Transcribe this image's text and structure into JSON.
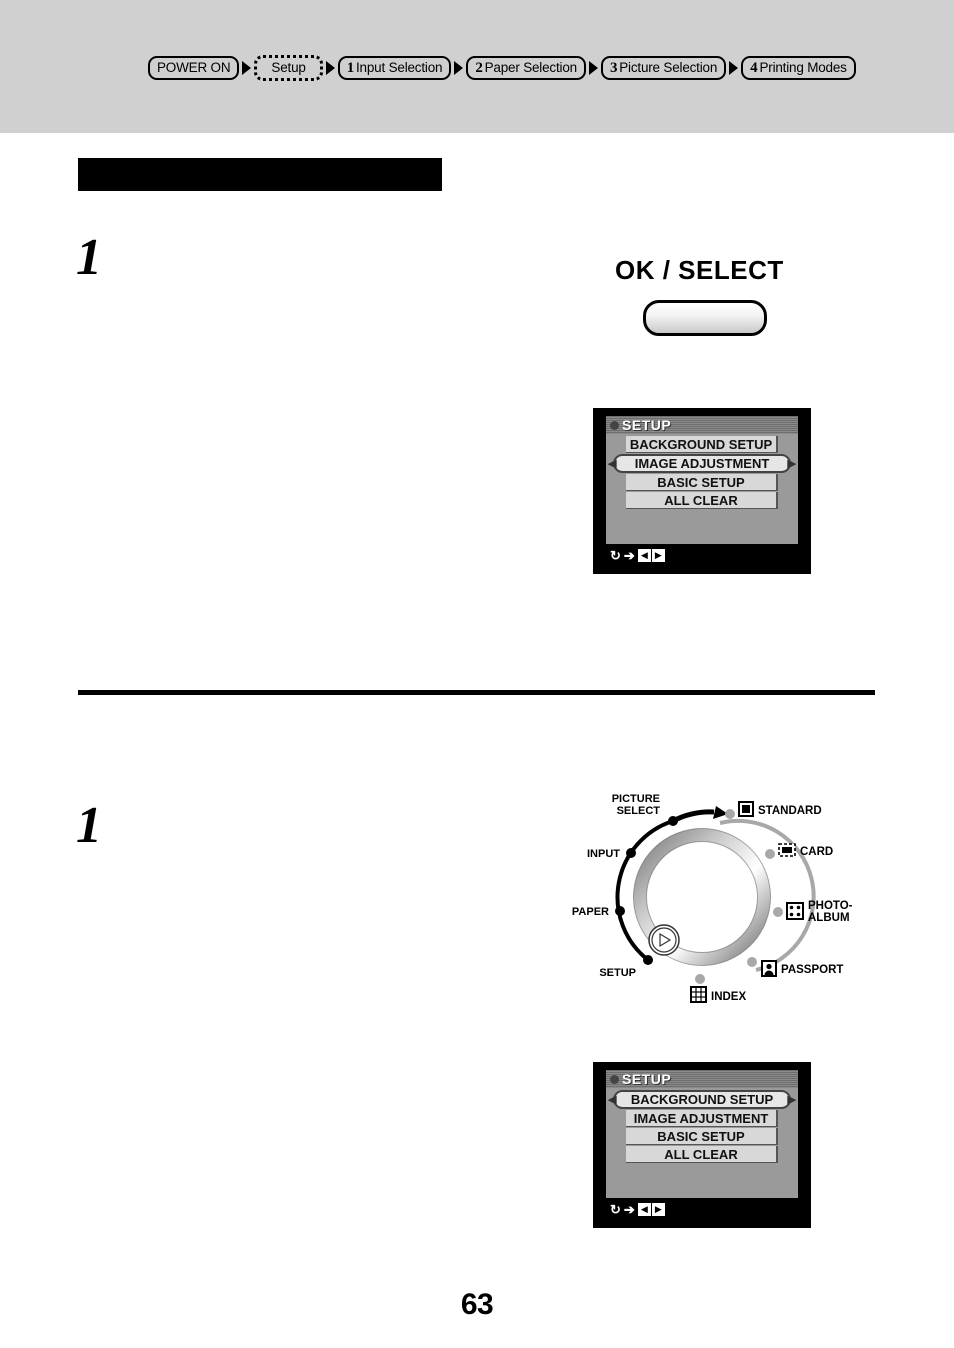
{
  "header": {
    "breadcrumb": [
      {
        "num": "",
        "label": "POWER ON",
        "state": "plain"
      },
      {
        "num": "",
        "label": "Setup",
        "state": "active"
      },
      {
        "num": "1",
        "label": "Input Selection",
        "state": "plain"
      },
      {
        "num": "2",
        "label": "Paper Selection",
        "state": "plain"
      },
      {
        "num": "3",
        "label": "Picture Selection",
        "state": "plain"
      },
      {
        "num": "4",
        "label": "Printing Modes",
        "state": "plain"
      }
    ]
  },
  "section": {
    "title": ""
  },
  "steps": {
    "first": "1",
    "second": "1"
  },
  "ok_select": {
    "label": "OK / SELECT"
  },
  "lcd_top": {
    "title": "SETUP",
    "rows": [
      {
        "label": "BACKGROUND SETUP",
        "selected": false
      },
      {
        "label": "IMAGE ADJUSTMENT",
        "selected": true
      },
      {
        "label": "BASIC SETUP",
        "selected": false
      },
      {
        "label": "ALL CLEAR",
        "selected": false
      }
    ],
    "footer": {
      "loop": "↻",
      "arrow": "➔",
      "left": "◀",
      "right": "▶"
    }
  },
  "lcd_bottom": {
    "title": "SETUP",
    "rows": [
      {
        "label": "BACKGROUND SETUP",
        "selected": true
      },
      {
        "label": "IMAGE ADJUSTMENT",
        "selected": false
      },
      {
        "label": "BASIC SETUP",
        "selected": false
      },
      {
        "label": "ALL CLEAR",
        "selected": false
      }
    ],
    "footer": {
      "loop": "↻",
      "arrow": "➔",
      "left": "◀",
      "right": "▶"
    }
  },
  "dial": {
    "left_labels": [
      {
        "id": "picture-select",
        "line1": "PICTURE",
        "line2": "SELECT"
      },
      {
        "id": "input",
        "line1": "INPUT",
        "line2": ""
      },
      {
        "id": "paper",
        "line1": "PAPER",
        "line2": ""
      },
      {
        "id": "setup",
        "line1": "SETUP",
        "line2": ""
      }
    ],
    "right_labels": [
      {
        "id": "standard",
        "line1": "STANDARD",
        "line2": "",
        "icon": "solid-square-icon"
      },
      {
        "id": "card",
        "line1": "CARD",
        "line2": "",
        "icon": "card-icon"
      },
      {
        "id": "photo-album",
        "line1": "PHOTO-",
        "line2": "ALBUM",
        "icon": "photo-album-icon"
      },
      {
        "id": "passport",
        "line1": "PASSPORT",
        "line2": "",
        "icon": "passport-icon"
      },
      {
        "id": "index",
        "line1": "INDEX",
        "line2": "",
        "icon": "index-grid-icon"
      }
    ]
  },
  "footer": {
    "page_number": "63"
  },
  "colors": {
    "header_band": "#d0d0d0",
    "section_bar": "#000000",
    "lcd_bezel": "#000000",
    "lcd_screen": "#9a9a9a",
    "dial_accent": "#9a9a9a"
  }
}
